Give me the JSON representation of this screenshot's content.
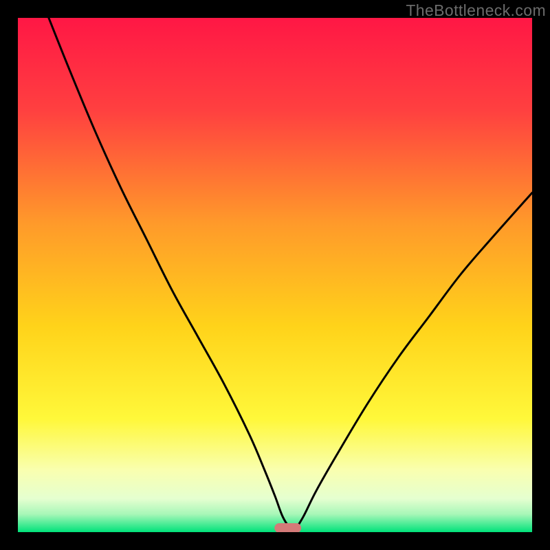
{
  "watermark": {
    "text": "TheBottleneck.com"
  },
  "chart_data": {
    "type": "line",
    "title": "",
    "xlabel": "",
    "ylabel": "",
    "xlim": [
      0,
      100
    ],
    "ylim": [
      0,
      100
    ],
    "grid": false,
    "legend": false,
    "background_gradient": {
      "stops": [
        {
          "offset": 0.0,
          "color": "#ff1745"
        },
        {
          "offset": 0.18,
          "color": "#ff4040"
        },
        {
          "offset": 0.4,
          "color": "#ff9a2a"
        },
        {
          "offset": 0.6,
          "color": "#ffd31a"
        },
        {
          "offset": 0.78,
          "color": "#fff83a"
        },
        {
          "offset": 0.88,
          "color": "#f9ffb0"
        },
        {
          "offset": 0.935,
          "color": "#e5ffd0"
        },
        {
          "offset": 0.965,
          "color": "#a8f7b8"
        },
        {
          "offset": 1.0,
          "color": "#00e27a"
        }
      ]
    },
    "series": [
      {
        "name": "bottleneck-curve",
        "color": "#000000",
        "x": [
          6,
          10,
          15,
          20,
          25,
          30,
          35,
          40,
          45,
          48,
          50,
          51.5,
          53,
          54,
          55.5,
          58,
          62,
          68,
          74,
          80,
          86,
          92,
          100
        ],
        "y": [
          100,
          90,
          78,
          67,
          57,
          47,
          38,
          29,
          19,
          12,
          7,
          3,
          0.8,
          0.8,
          3,
          8,
          15,
          25,
          34,
          42,
          50,
          57,
          66
        ]
      }
    ],
    "optimum_marker": {
      "shape": "rounded-bar",
      "x_center": 52.5,
      "width": 5.2,
      "y": 0.8,
      "color": "#d47a78"
    }
  }
}
